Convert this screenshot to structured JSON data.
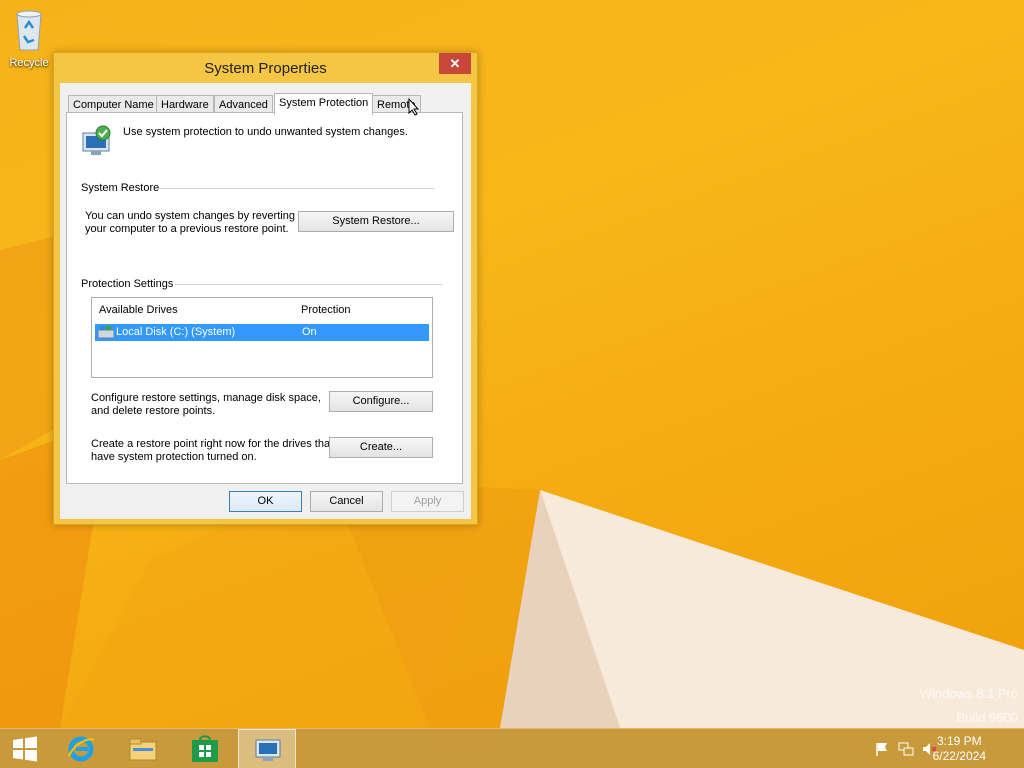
{
  "desktop": {
    "recycle_label": "Recycle",
    "watermark_line1": "Windows 8.1 Pro",
    "watermark_line2": "Build 9600"
  },
  "dialog": {
    "title": "System Properties",
    "close_glyph": "✕",
    "tabs": [
      {
        "label": "Computer Name",
        "active": false
      },
      {
        "label": "Hardware",
        "active": false
      },
      {
        "label": "Advanced",
        "active": false
      },
      {
        "label": "System Protection",
        "active": true
      },
      {
        "label": "Remote",
        "active": false
      }
    ],
    "intro_text": "Use system protection to undo unwanted system changes.",
    "system_restore": {
      "group_label": "System Restore",
      "description_line1": "You can undo system changes by reverting",
      "description_line2": "your computer to a previous restore point.",
      "button_label": "System Restore..."
    },
    "protection_settings": {
      "group_label": "Protection Settings",
      "columns": [
        "Available Drives",
        "Protection"
      ],
      "rows": [
        {
          "drive": "Local Disk (C:) (System)",
          "protection": "On",
          "selected": true
        }
      ],
      "configure_text_line1": "Configure restore settings, manage disk space,",
      "configure_text_line2": "and delete restore points.",
      "configure_button": "Configure...",
      "create_text_line1": "Create a restore point right now for the drives that",
      "create_text_line2": "have system protection turned on.",
      "create_button": "Create..."
    },
    "footer": {
      "ok": "OK",
      "cancel": "Cancel",
      "apply": "Apply"
    }
  },
  "taskbar": {
    "items": [
      "start-icon",
      "internet-explorer-icon",
      "file-explorer-icon",
      "store-icon",
      "system-properties-icon"
    ],
    "tray_icons": [
      "flag-icon",
      "network-icon",
      "volume-muted-icon"
    ],
    "time": "3:19 PM",
    "date": "6/22/2024"
  },
  "colors": {
    "accent": "#f5c544",
    "selection": "#3399ff",
    "close": "#c7483b",
    "taskbar": "#c89a3c"
  }
}
